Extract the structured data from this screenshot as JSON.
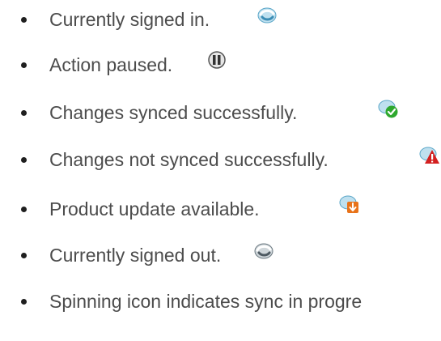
{
  "items": [
    {
      "label": "Currently signed in.",
      "icon": "sync-signed-in-icon"
    },
    {
      "label": "Action paused.",
      "icon": "pause-icon"
    },
    {
      "label": "Changes synced successfully.",
      "icon": "sync-success-icon"
    },
    {
      "label": "Changes not synced successfully.",
      "icon": "sync-error-icon"
    },
    {
      "label": "Product update available.",
      "icon": "update-available-icon"
    },
    {
      "label": "Currently signed out.",
      "icon": "sync-signed-out-icon"
    },
    {
      "label": "Spinning icon indicates sync in progre",
      "icon": null
    }
  ],
  "colors": {
    "text": "#4c4c4c",
    "bullet": "#1f1f1f",
    "sync_blue": "#5aa6c8",
    "success_green": "#2ea82e",
    "error_red": "#d32020",
    "update_orange": "#e8731a",
    "signed_out_gray": "#6d7a82"
  }
}
